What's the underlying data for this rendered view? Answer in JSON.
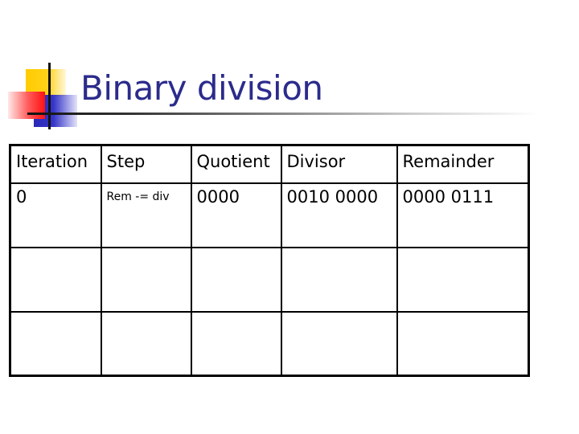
{
  "slide": {
    "title": "Binary division",
    "colors": {
      "title": "#2b2b8c",
      "logo_yellow": "#ffcc00",
      "logo_red": "#ff1010",
      "logo_blue": "#2a2ab8"
    }
  },
  "table": {
    "headers": [
      "Iteration",
      "Step",
      "Quotient",
      "Divisor",
      "Remainder"
    ],
    "rows": [
      [
        "0",
        "Rem -= div",
        "0000",
        "0010 0000",
        "0000 0111"
      ],
      [
        "",
        "",
        "",
        "",
        ""
      ],
      [
        "",
        "",
        "",
        "",
        ""
      ]
    ]
  }
}
